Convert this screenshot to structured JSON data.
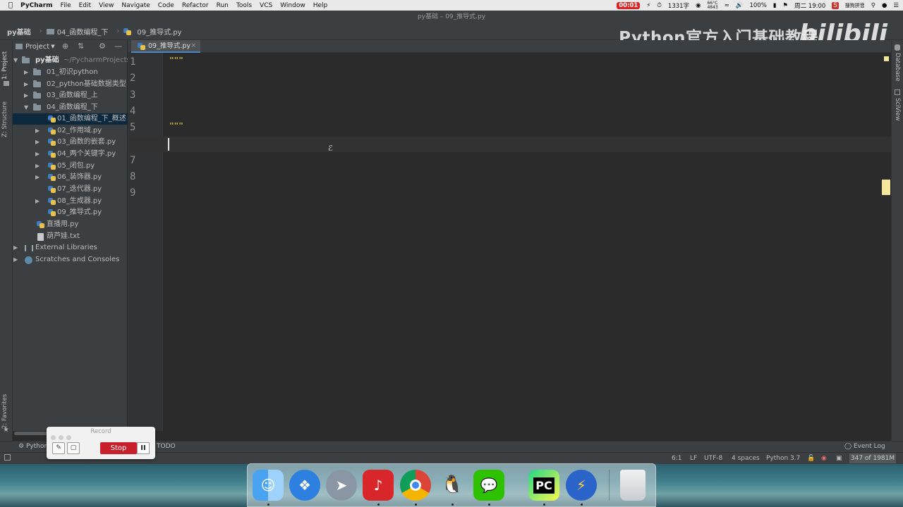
{
  "menubar": {
    "app_name": "PyCharm",
    "items": [
      "File",
      "Edit",
      "View",
      "Navigate",
      "Code",
      "Refactor",
      "Run",
      "Tools",
      "VCS",
      "Window",
      "Help"
    ],
    "record_time": "00:01",
    "word_count": "1331字",
    "temp_top": "66°C",
    "temp_bottom": "4843",
    "battery": "100%",
    "datetime": "周二 19:00",
    "ime": "搜狗拼音"
  },
  "window": {
    "title": "py基础 – 09_推导式.py"
  },
  "navbar": {
    "crumbs": [
      "py基础",
      "04_函数编程_下",
      "09_推导式.py"
    ]
  },
  "watermark": {
    "text": "Python官方入门基础教程",
    "logo": "bilibili"
  },
  "left_stripe": {
    "project_tab": "1: Project",
    "structure_tab": "Z: Structure",
    "favorites_tab": "2: Favorites"
  },
  "project_panel": {
    "header_label": "Project",
    "root_label": "py基础",
    "root_path": "~/PycharmProjects",
    "items": [
      {
        "label": "01_初识python"
      },
      {
        "label": "02_python基础数据类型"
      },
      {
        "label": "03_函数编程_上"
      },
      {
        "label": "04_函数编程_下"
      },
      {
        "label": "01_函数编程_下_概述"
      },
      {
        "label": "02_作用域.py"
      },
      {
        "label": "03_函数的嵌套.py"
      },
      {
        "label": "04_两个关键字.py"
      },
      {
        "label": "05_闭包.py"
      },
      {
        "label": "06_装饰器.py"
      },
      {
        "label": "07_迭代器.py"
      },
      {
        "label": "08_生成器.py"
      },
      {
        "label": "09_推导式.py"
      },
      {
        "label": "直播用.py"
      },
      {
        "label": "葫芦娃.txt"
      },
      {
        "label": "External Libraries"
      },
      {
        "label": "Scratches and Consoles"
      }
    ]
  },
  "editor": {
    "tab_label": "09_推导式.py",
    "line_numbers": [
      "1",
      "2",
      "3",
      "4",
      "5",
      "6",
      "7",
      "8",
      "9"
    ],
    "lines": [
      "\"\"\"",
      "",
      "",
      "",
      "\"\"\"",
      "",
      "",
      "",
      ""
    ]
  },
  "right_stripe": {
    "database_tab": "Database",
    "sciview_tab": "SciView"
  },
  "bottom_bar": {
    "python_console": "Python Console",
    "todo": "TODO",
    "event_log": "Event Log"
  },
  "statusbar": {
    "position": "6:1",
    "line_sep": "LF",
    "encoding": "UTF-8",
    "indent": "4 spaces",
    "interpreter": "Python 3.7",
    "memory": "347 of 1981M"
  },
  "record_widget": {
    "title": "Record",
    "stop_label": "Stop",
    "pause_label": "II"
  },
  "dock": {
    "pycharm_label": "PC"
  }
}
